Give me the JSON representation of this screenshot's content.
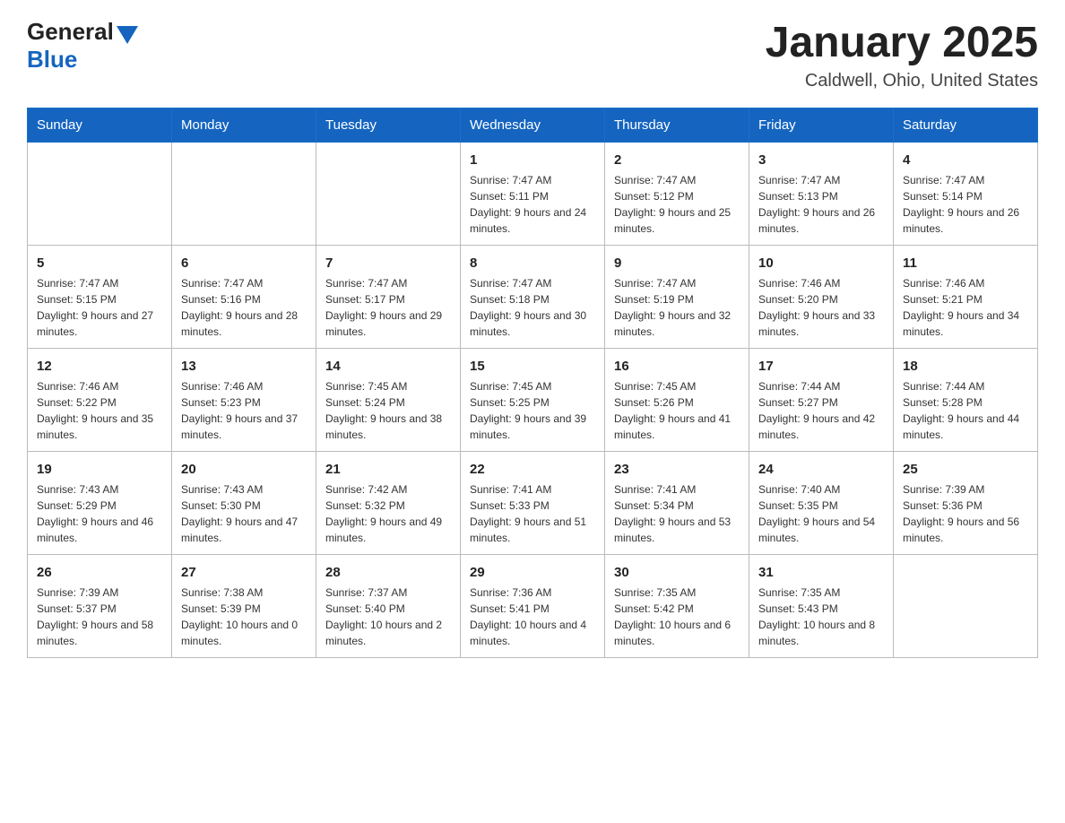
{
  "logo": {
    "general": "General",
    "blue": "Blue"
  },
  "title": "January 2025",
  "subtitle": "Caldwell, Ohio, United States",
  "days_of_week": [
    "Sunday",
    "Monday",
    "Tuesday",
    "Wednesday",
    "Thursday",
    "Friday",
    "Saturday"
  ],
  "weeks": [
    [
      {
        "day": "",
        "sunrise": "",
        "sunset": "",
        "daylight": ""
      },
      {
        "day": "",
        "sunrise": "",
        "sunset": "",
        "daylight": ""
      },
      {
        "day": "",
        "sunrise": "",
        "sunset": "",
        "daylight": ""
      },
      {
        "day": "1",
        "sunrise": "Sunrise: 7:47 AM",
        "sunset": "Sunset: 5:11 PM",
        "daylight": "Daylight: 9 hours and 24 minutes."
      },
      {
        "day": "2",
        "sunrise": "Sunrise: 7:47 AM",
        "sunset": "Sunset: 5:12 PM",
        "daylight": "Daylight: 9 hours and 25 minutes."
      },
      {
        "day": "3",
        "sunrise": "Sunrise: 7:47 AM",
        "sunset": "Sunset: 5:13 PM",
        "daylight": "Daylight: 9 hours and 26 minutes."
      },
      {
        "day": "4",
        "sunrise": "Sunrise: 7:47 AM",
        "sunset": "Sunset: 5:14 PM",
        "daylight": "Daylight: 9 hours and 26 minutes."
      }
    ],
    [
      {
        "day": "5",
        "sunrise": "Sunrise: 7:47 AM",
        "sunset": "Sunset: 5:15 PM",
        "daylight": "Daylight: 9 hours and 27 minutes."
      },
      {
        "day": "6",
        "sunrise": "Sunrise: 7:47 AM",
        "sunset": "Sunset: 5:16 PM",
        "daylight": "Daylight: 9 hours and 28 minutes."
      },
      {
        "day": "7",
        "sunrise": "Sunrise: 7:47 AM",
        "sunset": "Sunset: 5:17 PM",
        "daylight": "Daylight: 9 hours and 29 minutes."
      },
      {
        "day": "8",
        "sunrise": "Sunrise: 7:47 AM",
        "sunset": "Sunset: 5:18 PM",
        "daylight": "Daylight: 9 hours and 30 minutes."
      },
      {
        "day": "9",
        "sunrise": "Sunrise: 7:47 AM",
        "sunset": "Sunset: 5:19 PM",
        "daylight": "Daylight: 9 hours and 32 minutes."
      },
      {
        "day": "10",
        "sunrise": "Sunrise: 7:46 AM",
        "sunset": "Sunset: 5:20 PM",
        "daylight": "Daylight: 9 hours and 33 minutes."
      },
      {
        "day": "11",
        "sunrise": "Sunrise: 7:46 AM",
        "sunset": "Sunset: 5:21 PM",
        "daylight": "Daylight: 9 hours and 34 minutes."
      }
    ],
    [
      {
        "day": "12",
        "sunrise": "Sunrise: 7:46 AM",
        "sunset": "Sunset: 5:22 PM",
        "daylight": "Daylight: 9 hours and 35 minutes."
      },
      {
        "day": "13",
        "sunrise": "Sunrise: 7:46 AM",
        "sunset": "Sunset: 5:23 PM",
        "daylight": "Daylight: 9 hours and 37 minutes."
      },
      {
        "day": "14",
        "sunrise": "Sunrise: 7:45 AM",
        "sunset": "Sunset: 5:24 PM",
        "daylight": "Daylight: 9 hours and 38 minutes."
      },
      {
        "day": "15",
        "sunrise": "Sunrise: 7:45 AM",
        "sunset": "Sunset: 5:25 PM",
        "daylight": "Daylight: 9 hours and 39 minutes."
      },
      {
        "day": "16",
        "sunrise": "Sunrise: 7:45 AM",
        "sunset": "Sunset: 5:26 PM",
        "daylight": "Daylight: 9 hours and 41 minutes."
      },
      {
        "day": "17",
        "sunrise": "Sunrise: 7:44 AM",
        "sunset": "Sunset: 5:27 PM",
        "daylight": "Daylight: 9 hours and 42 minutes."
      },
      {
        "day": "18",
        "sunrise": "Sunrise: 7:44 AM",
        "sunset": "Sunset: 5:28 PM",
        "daylight": "Daylight: 9 hours and 44 minutes."
      }
    ],
    [
      {
        "day": "19",
        "sunrise": "Sunrise: 7:43 AM",
        "sunset": "Sunset: 5:29 PM",
        "daylight": "Daylight: 9 hours and 46 minutes."
      },
      {
        "day": "20",
        "sunrise": "Sunrise: 7:43 AM",
        "sunset": "Sunset: 5:30 PM",
        "daylight": "Daylight: 9 hours and 47 minutes."
      },
      {
        "day": "21",
        "sunrise": "Sunrise: 7:42 AM",
        "sunset": "Sunset: 5:32 PM",
        "daylight": "Daylight: 9 hours and 49 minutes."
      },
      {
        "day": "22",
        "sunrise": "Sunrise: 7:41 AM",
        "sunset": "Sunset: 5:33 PM",
        "daylight": "Daylight: 9 hours and 51 minutes."
      },
      {
        "day": "23",
        "sunrise": "Sunrise: 7:41 AM",
        "sunset": "Sunset: 5:34 PM",
        "daylight": "Daylight: 9 hours and 53 minutes."
      },
      {
        "day": "24",
        "sunrise": "Sunrise: 7:40 AM",
        "sunset": "Sunset: 5:35 PM",
        "daylight": "Daylight: 9 hours and 54 minutes."
      },
      {
        "day": "25",
        "sunrise": "Sunrise: 7:39 AM",
        "sunset": "Sunset: 5:36 PM",
        "daylight": "Daylight: 9 hours and 56 minutes."
      }
    ],
    [
      {
        "day": "26",
        "sunrise": "Sunrise: 7:39 AM",
        "sunset": "Sunset: 5:37 PM",
        "daylight": "Daylight: 9 hours and 58 minutes."
      },
      {
        "day": "27",
        "sunrise": "Sunrise: 7:38 AM",
        "sunset": "Sunset: 5:39 PM",
        "daylight": "Daylight: 10 hours and 0 minutes."
      },
      {
        "day": "28",
        "sunrise": "Sunrise: 7:37 AM",
        "sunset": "Sunset: 5:40 PM",
        "daylight": "Daylight: 10 hours and 2 minutes."
      },
      {
        "day": "29",
        "sunrise": "Sunrise: 7:36 AM",
        "sunset": "Sunset: 5:41 PM",
        "daylight": "Daylight: 10 hours and 4 minutes."
      },
      {
        "day": "30",
        "sunrise": "Sunrise: 7:35 AM",
        "sunset": "Sunset: 5:42 PM",
        "daylight": "Daylight: 10 hours and 6 minutes."
      },
      {
        "day": "31",
        "sunrise": "Sunrise: 7:35 AM",
        "sunset": "Sunset: 5:43 PM",
        "daylight": "Daylight: 10 hours and 8 minutes."
      },
      {
        "day": "",
        "sunrise": "",
        "sunset": "",
        "daylight": ""
      }
    ]
  ]
}
